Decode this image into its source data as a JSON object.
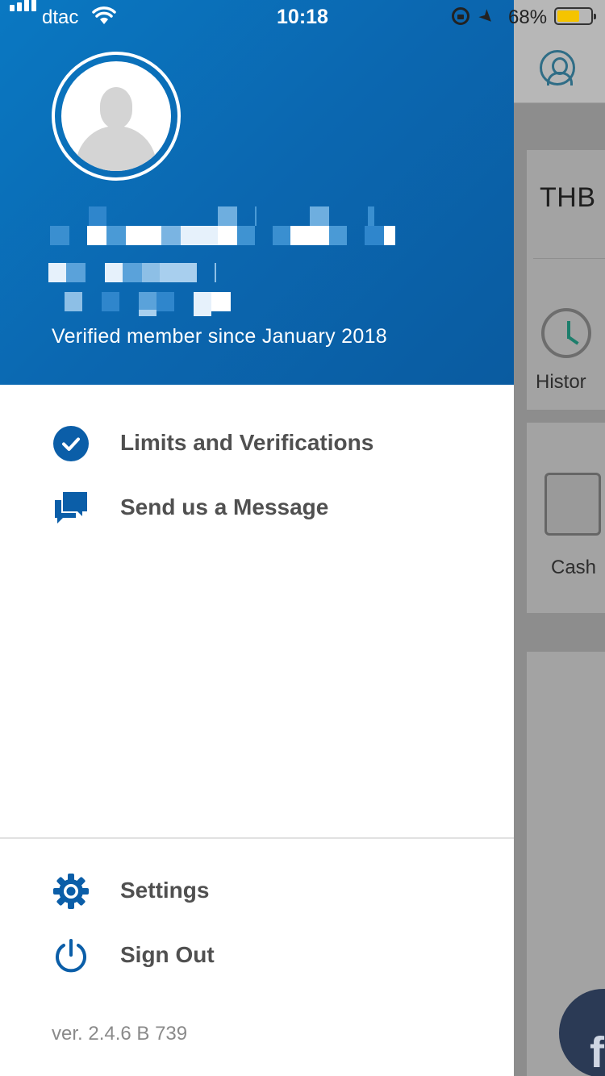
{
  "status_bar": {
    "carrier": "dtac",
    "time": "10:18",
    "battery_percent": "68%",
    "battery_level": 0.68,
    "battery_color": "#f5c400"
  },
  "background_app": {
    "currency": "THB",
    "history_label": "Histor",
    "cash_label": "Cash",
    "account_icon": "user-circle-icon",
    "fab_glyph": "f"
  },
  "drawer": {
    "profile": {
      "avatar_icon": "person-silhouette-icon",
      "verified_text": "Verified member since January 2018",
      "background_color": "#0a6cb5"
    },
    "menu": [
      {
        "id": "limits",
        "label": "Limits and Verifications",
        "icon": "check-circle-icon"
      },
      {
        "id": "message",
        "label": "Send us a Message",
        "icon": "chat-bubbles-icon"
      }
    ],
    "footer_menu": [
      {
        "id": "settings",
        "label": "Settings",
        "icon": "gear-icon"
      },
      {
        "id": "signout",
        "label": "Sign Out",
        "icon": "power-icon"
      }
    ],
    "version": "ver. 2.4.6 B 739",
    "accent_color": "#0b5ea8"
  }
}
